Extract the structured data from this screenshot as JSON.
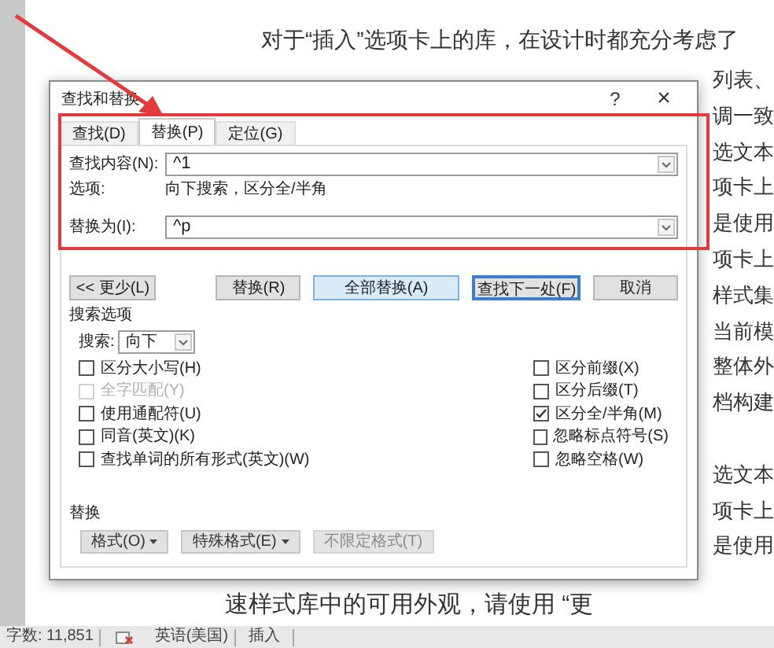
{
  "document": {
    "first_line": "对于“插入”选项卡上的库，在设计时都充分考虑了",
    "right_upper": [
      "列表、",
      "调一致",
      "选文本",
      "项卡上",
      "是使用",
      "项卡上",
      "样式集",
      "当前模",
      "整体外",
      "档构建"
    ],
    "right_lower": [
      "选文本",
      "项卡上",
      "是使用"
    ],
    "last_line": "速样式库中的可用外观，请使用 “更"
  },
  "dialog": {
    "title": "查找和替换",
    "help": "?",
    "close": "×",
    "tabs": [
      {
        "label": "查找(D)",
        "selected": false
      },
      {
        "label": "替换(P)",
        "selected": true
      },
      {
        "label": "定位(G)",
        "selected": false
      }
    ],
    "find": {
      "label": "查找内容(N):",
      "value": "^1"
    },
    "options": {
      "label": "选项:",
      "value": "向下搜索，区分全/半角"
    },
    "replace": {
      "label": "替换为(I):",
      "value": "^p"
    },
    "buttons": [
      {
        "label": "<< 更少(L)",
        "kind": "plain"
      },
      {
        "label": "替换(R)",
        "kind": "plain"
      },
      {
        "label": "全部替换(A)",
        "kind": "default"
      },
      {
        "label": "查找下一处(F)",
        "kind": "focused"
      },
      {
        "label": "取消",
        "kind": "plain"
      }
    ],
    "search_options": {
      "heading": "搜索选项",
      "direction_label": "搜索:",
      "direction": "向下",
      "left": [
        {
          "label": "区分大小写(H)",
          "checked": false,
          "disabled": false
        },
        {
          "label": "全字匹配(Y)",
          "checked": false,
          "disabled": true
        },
        {
          "label": "使用通配符(U)",
          "checked": false,
          "disabled": false
        },
        {
          "label": "同音(英文)(K)",
          "checked": false,
          "disabled": false
        },
        {
          "label": "查找单词的所有形式(英文)(W)",
          "checked": false,
          "disabled": false
        }
      ],
      "right": [
        {
          "label": "区分前缀(X)",
          "checked": false,
          "disabled": false
        },
        {
          "label": "区分后缀(T)",
          "checked": false,
          "disabled": false
        },
        {
          "label": "区分全/半角(M)",
          "checked": true,
          "disabled": false
        },
        {
          "label": "忽略标点符号(S)",
          "checked": false,
          "disabled": false
        },
        {
          "label": "忽略空格(W)",
          "checked": false,
          "disabled": false
        }
      ]
    },
    "replace_section": {
      "heading": "替换",
      "buttons": [
        {
          "label": "格式(O)",
          "menu": true,
          "disabled": false
        },
        {
          "label": "特殊格式(E)",
          "menu": true,
          "disabled": false
        },
        {
          "label": "不限定格式(T)",
          "menu": false,
          "disabled": true
        }
      ]
    }
  },
  "status_bar": {
    "word_count": "字数: 11,851",
    "language": "英语(美国)",
    "mode": "插入"
  }
}
